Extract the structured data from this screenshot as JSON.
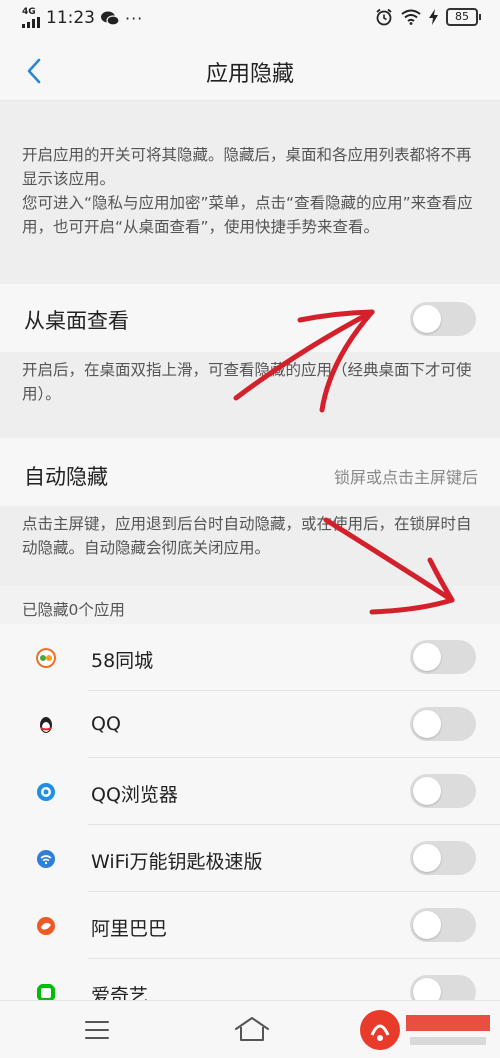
{
  "status_bar": {
    "network": "4G",
    "time": "11:23",
    "battery": "85"
  },
  "nav": {
    "title": "应用隐藏"
  },
  "intro": {
    "line1": "开启应用的开关可将其隐藏。隐藏后，桌面和各应用列表都将不再显示该应用。",
    "line2": "您可进入“隐私与应用加密”菜单，点击“查看隐藏的应用”来查看应用，也可开启“从桌面查看”，使用快捷手势来查看。"
  },
  "view_from_desktop": {
    "label": "从桌面查看",
    "enabled": false,
    "desc": "开启后，在桌面双指上滑，可查看隐藏的应用（经典桌面下才可使用）。"
  },
  "auto_hide": {
    "label": "自动隐藏",
    "value": "锁屏或点击主屏键后",
    "desc": "点击主屏键，应用退到后台时自动隐藏，或在使用后，在锁屏时自动隐藏。自动隐藏会彻底关闭应用。"
  },
  "hidden_count": "已隐藏0个应用",
  "apps": [
    {
      "name": "58同城",
      "icon": "58-tongcheng-icon",
      "color": "#f26b21",
      "enabled": false
    },
    {
      "name": "QQ",
      "icon": "qq-penguin-icon",
      "color": "#222222",
      "enabled": false
    },
    {
      "name": "QQ浏览器",
      "icon": "qq-browser-icon",
      "color": "#1e8ee6",
      "enabled": false
    },
    {
      "name": "WiFi万能钥匙极速版",
      "icon": "wifi-key-icon",
      "color": "#2f7fd9",
      "enabled": false
    },
    {
      "name": "阿里巴巴",
      "icon": "alibaba-icon",
      "color": "#ee5a24",
      "enabled": false
    },
    {
      "name": "爱奇艺",
      "icon": "iqiyi-icon",
      "color": "#00be06",
      "enabled": false
    }
  ],
  "colors": {
    "accent": "#2a86d6",
    "toggle_off": "#dcdcdc",
    "annotation": "#d4202a"
  }
}
